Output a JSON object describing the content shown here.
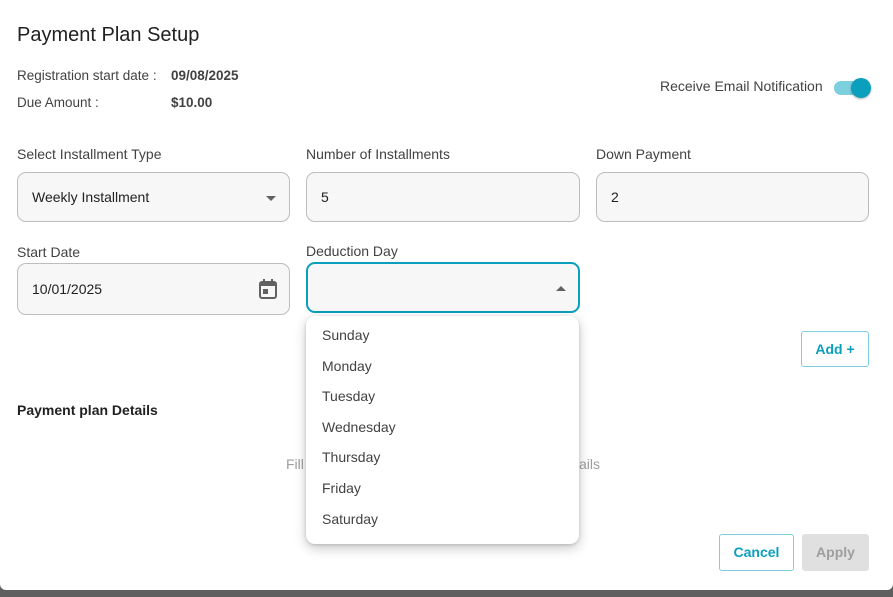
{
  "dialog": {
    "title": "Payment Plan Setup",
    "registration_label": "Registration start date :",
    "registration_value": "09/08/2025",
    "due_label": "Due Amount :",
    "due_value": "$10.00",
    "email_notification_label": "Receive Email Notification",
    "email_notification_on": true
  },
  "form": {
    "installment_type_label": "Select Installment Type",
    "installment_type_value": "Weekly Installment",
    "num_installments_label": "Number of Installments",
    "num_installments_value": "5",
    "down_payment_label": "Down Payment",
    "down_payment_value": "2",
    "start_date_label": "Start Date",
    "start_date_value": "10/01/2025",
    "deduction_day_label": "Deduction Day",
    "deduction_day_value": "",
    "add_label": "Add +"
  },
  "details": {
    "title": "Payment plan Details",
    "hint_left": "Fill",
    "hint_right": "ails"
  },
  "menu": {
    "options": [
      "Sunday",
      "Monday",
      "Tuesday",
      "Wednesday",
      "Thursday",
      "Friday",
      "Saturday"
    ]
  },
  "footer": {
    "cancel_label": "Cancel",
    "apply_label": "Apply"
  },
  "colors": {
    "accent": "#0a9fbd",
    "toggle_track": "#7ccfdc"
  }
}
